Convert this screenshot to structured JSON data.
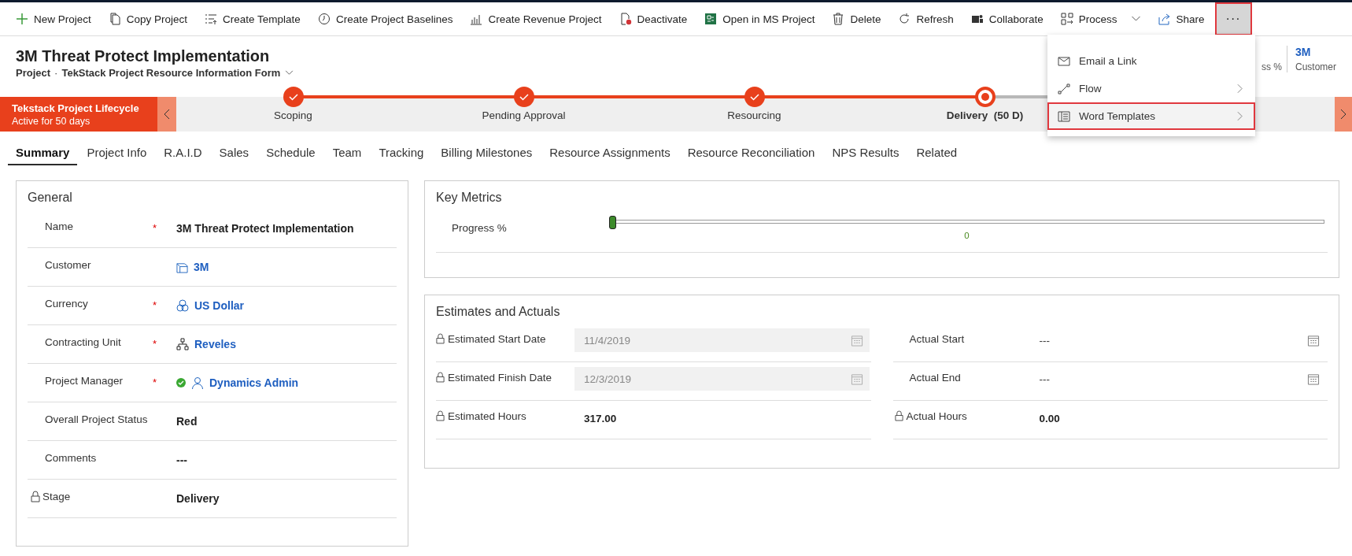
{
  "toolbar": {
    "items": [
      {
        "label": "New Project"
      },
      {
        "label": "Copy Project"
      },
      {
        "label": "Create Template"
      },
      {
        "label": "Create Project Baselines"
      },
      {
        "label": "Create Revenue Project"
      },
      {
        "label": "Deactivate"
      },
      {
        "label": "Open in MS Project"
      },
      {
        "label": "Delete"
      },
      {
        "label": "Refresh"
      },
      {
        "label": "Collaborate"
      },
      {
        "label": "Process",
        "dropdown": true
      },
      {
        "label": "Share"
      }
    ],
    "more": {
      "label": "···",
      "highlighted": true
    }
  },
  "header": {
    "title": "3M Threat Protect Implementation",
    "entity": "Project",
    "separator": "·",
    "form": "TekStack Project Resource Information Form",
    "fields": [
      {
        "label": "ss %"
      },
      {
        "value": "3M",
        "label": "Customer"
      }
    ]
  },
  "more_menu": [
    {
      "label": "Email a Link",
      "highlighted": false
    },
    {
      "label": "Flow",
      "submenu": true,
      "highlighted": false
    },
    {
      "label": "Word Templates",
      "submenu": true,
      "highlighted": true
    }
  ],
  "process": {
    "name": "Tekstack Project Lifecycle",
    "duration": "Active for 50 days",
    "stages": [
      {
        "label": "Scoping",
        "completed": true,
        "active": false
      },
      {
        "label": "Pending Approval",
        "completed": true,
        "active": false
      },
      {
        "label": "Resourcing",
        "completed": true,
        "active": false
      },
      {
        "label": "Delivery",
        "days": "(50 D)",
        "completed": false,
        "active": true
      }
    ]
  },
  "tabs": [
    {
      "label": "Summary",
      "selected": true
    },
    {
      "label": "Project Info",
      "selected": false
    },
    {
      "label": "R.A.I.D",
      "selected": false
    },
    {
      "label": "Sales",
      "selected": false
    },
    {
      "label": "Schedule",
      "selected": false
    },
    {
      "label": "Team",
      "selected": false
    },
    {
      "label": "Tracking",
      "selected": false
    },
    {
      "label": "Billing Milestones",
      "selected": false
    },
    {
      "label": "Resource Assignments",
      "selected": false
    },
    {
      "label": "Resource Reconciliation",
      "selected": false
    },
    {
      "label": "NPS Results",
      "selected": false
    },
    {
      "label": "Related",
      "selected": false
    }
  ],
  "general": {
    "title": "General",
    "fields": [
      {
        "label": "Name",
        "required_mark": "*",
        "kind": "text",
        "value": "3M Threat Protect Implementation"
      },
      {
        "label": "Customer",
        "kind": "account",
        "value": "3M"
      },
      {
        "label": "Currency",
        "required_mark": "*",
        "kind": "currency",
        "value": "US Dollar"
      },
      {
        "label": "Contracting Unit",
        "required_mark": "*",
        "kind": "unit",
        "value": "Reveles"
      },
      {
        "label": "Project Manager",
        "required_mark": "*",
        "kind": "user",
        "available": true,
        "value": "Dynamics Admin"
      },
      {
        "label": "Overall Project Status",
        "kind": "text",
        "value": "Red"
      },
      {
        "label": "Comments",
        "kind": "empty",
        "value": "---"
      },
      {
        "label": "Stage",
        "locked": true,
        "kind": "plain",
        "value": "Delivery"
      }
    ]
  },
  "key_metrics": {
    "title": "Key Metrics",
    "label": "Progress %",
    "level": 0,
    "reading": "0"
  },
  "estimates": {
    "title": "Estimates and Actuals",
    "columns": [
      [
        {
          "label": "Estimated Start Date",
          "locked": true,
          "kind": "date",
          "disabled": true,
          "value": "11/4/2019"
        },
        {
          "label": "Estimated Finish Date",
          "locked": true,
          "kind": "date",
          "disabled": true,
          "value": "12/3/2019"
        },
        {
          "label": "Estimated Hours",
          "locked": true,
          "kind": "number",
          "value": "317.00"
        }
      ],
      [
        {
          "label": "Actual Start",
          "kind": "date",
          "disabled": false,
          "value": "---"
        },
        {
          "label": "Actual End",
          "kind": "date",
          "disabled": false,
          "value": "---"
        },
        {
          "label": "Actual Hours",
          "locked": true,
          "kind": "number",
          "value": "0.00"
        }
      ]
    ]
  }
}
